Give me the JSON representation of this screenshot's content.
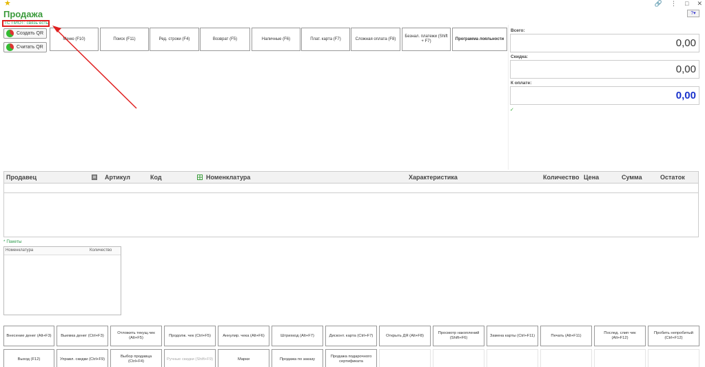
{
  "window": {
    "title": "Продажа",
    "controls": [
      "🔗",
      "⋮",
      "□",
      "✕"
    ]
  },
  "status": {
    "text": "ТС ПИОТ: связь есть"
  },
  "qr_buttons": [
    {
      "label": "Создать QR"
    },
    {
      "label": "Считать QR"
    }
  ],
  "toolbar": [
    "Меню (F10)",
    "Поиск (F11)",
    "Ред. строки (F4)",
    "Возврат (F5)",
    "Наличные (F6)",
    "Плат. карта (F7)",
    "Сложная оплата (F8)",
    "Безнал. платежи (Shift + F7)",
    "Программа лояльности"
  ],
  "totals": {
    "total_label": "Всего:",
    "total_value": "0,00",
    "discount_label": "Скидка:",
    "discount_value": "0,00",
    "topay_label": "К оплате:",
    "topay_value": "0,00"
  },
  "table": {
    "columns": [
      "Продавец",
      "Артикул",
      "Код",
      "Номенклатура",
      "Характеристика",
      "Количество",
      "Цена",
      "Сумма",
      "Остаток"
    ]
  },
  "packages": {
    "label": "* Пакеты",
    "columns": [
      "Номенклатура",
      "Количество"
    ]
  },
  "bottom_row1": [
    "Внесение денег (Alt+F3)",
    "Выемка денег (Ctrl+F3)",
    "Отложить текущ.чек (Alt+F5)",
    "Продолж. чек (Ctrl+F5)",
    "Аннулир. чека (Alt+F6)",
    "Штрихкод (Alt+F7)",
    "Дисконт. карта (Ctrl+F7)",
    "Открыть ДЯ (Alt+F8)",
    "Просмотр накоплений (Shift+F6)",
    "Замена карты (Ctrl+F11)",
    "Печать (Alt+F11)",
    "Послед. слип чек (Alt+F12)",
    "Пробить непробитый (Ctrl+F12)"
  ],
  "bottom_row2": [
    "Выход (F12)",
    "Управл. скидки (Ctrl+F9)",
    "Выбор продавца (Ctrl+F4)",
    "Ручные скидки (Shift+F9)",
    "Марки",
    "Продажа по заказу",
    "Продажа подарочного сертификата"
  ],
  "colors": {
    "title": "#3a9a3a",
    "status_border": "#e02020",
    "topay": "#1a33cc",
    "arrow": "#e02020"
  }
}
